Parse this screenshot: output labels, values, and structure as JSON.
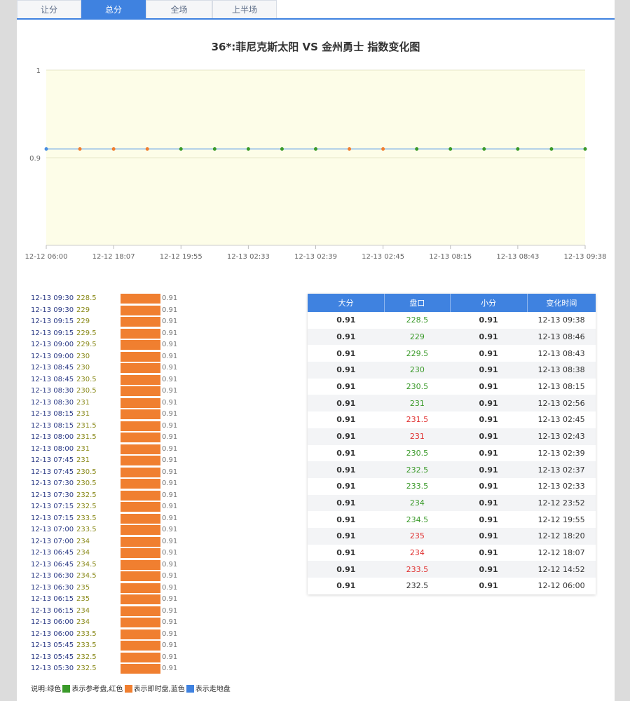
{
  "tabs": [
    "让分",
    "总分",
    "全场",
    "上半场"
  ],
  "active_tab": 1,
  "chart_data": {
    "type": "line",
    "title": "36*:菲尼克斯太阳 VS 金州勇士 指数变化图",
    "ylim": [
      0.8,
      1
    ],
    "yticks": [
      "1",
      "0.9"
    ],
    "xticks": [
      "12-12 06:00",
      "12-12 18:07",
      "12-12 19:55",
      "12-13 02:33",
      "12-13 02:39",
      "12-13 02:45",
      "12-13 08:15",
      "12-13 08:43",
      "12-13 09:38"
    ],
    "series": [
      {
        "values": [
          0.91,
          0.91,
          0.91,
          0.91,
          0.91,
          0.91,
          0.91,
          0.91,
          0.91,
          0.91,
          0.91,
          0.91,
          0.91,
          0.91,
          0.91,
          0.91,
          0.91
        ],
        "point_colors": [
          "#4a8fe0",
          "#f07f30",
          "#f07f30",
          "#f07f30",
          "#3a9a2a",
          "#3a9a2a",
          "#3a9a2a",
          "#3a9a2a",
          "#3a9a2a",
          "#f07f30",
          "#f07f30",
          "#3a9a2a",
          "#3a9a2a",
          "#3a9a2a",
          "#3a9a2a",
          "#3a9a2a",
          "#3a9a2a"
        ]
      }
    ],
    "line_color": "#7fb2e8",
    "plot_bg": "#fdfde8"
  },
  "rows": [
    {
      "time": "12-13 09:30",
      "line": "228.5",
      "value": "0.91"
    },
    {
      "time": "12-13 09:30",
      "line": "229",
      "value": "0.91"
    },
    {
      "time": "12-13 09:15",
      "line": "229",
      "value": "0.91"
    },
    {
      "time": "12-13 09:15",
      "line": "229.5",
      "value": "0.91"
    },
    {
      "time": "12-13 09:00",
      "line": "229.5",
      "value": "0.91"
    },
    {
      "time": "12-13 09:00",
      "line": "230",
      "value": "0.91"
    },
    {
      "time": "12-13 08:45",
      "line": "230",
      "value": "0.91"
    },
    {
      "time": "12-13 08:45",
      "line": "230.5",
      "value": "0.91"
    },
    {
      "time": "12-13 08:30",
      "line": "230.5",
      "value": "0.91"
    },
    {
      "time": "12-13 08:30",
      "line": "231",
      "value": "0.91"
    },
    {
      "time": "12-13 08:15",
      "line": "231",
      "value": "0.91"
    },
    {
      "time": "12-13 08:15",
      "line": "231.5",
      "value": "0.91"
    },
    {
      "time": "12-13 08:00",
      "line": "231.5",
      "value": "0.91"
    },
    {
      "time": "12-13 08:00",
      "line": "231",
      "value": "0.91"
    },
    {
      "time": "12-13 07:45",
      "line": "231",
      "value": "0.91"
    },
    {
      "time": "12-13 07:45",
      "line": "230.5",
      "value": "0.91"
    },
    {
      "time": "12-13 07:30",
      "line": "230.5",
      "value": "0.91"
    },
    {
      "time": "12-13 07:30",
      "line": "232.5",
      "value": "0.91"
    },
    {
      "time": "12-13 07:15",
      "line": "232.5",
      "value": "0.91"
    },
    {
      "time": "12-13 07:15",
      "line": "233.5",
      "value": "0.91"
    },
    {
      "time": "12-13 07:00",
      "line": "233.5",
      "value": "0.91"
    },
    {
      "time": "12-13 07:00",
      "line": "234",
      "value": "0.91"
    },
    {
      "time": "12-13 06:45",
      "line": "234",
      "value": "0.91"
    },
    {
      "time": "12-13 06:45",
      "line": "234.5",
      "value": "0.91"
    },
    {
      "time": "12-13 06:30",
      "line": "234.5",
      "value": "0.91"
    },
    {
      "time": "12-13 06:30",
      "line": "235",
      "value": "0.91"
    },
    {
      "time": "12-13 06:15",
      "line": "235",
      "value": "0.91"
    },
    {
      "time": "12-13 06:15",
      "line": "234",
      "value": "0.91"
    },
    {
      "time": "12-13 06:00",
      "line": "234",
      "value": "0.91"
    },
    {
      "time": "12-13 06:00",
      "line": "233.5",
      "value": "0.91"
    },
    {
      "time": "12-13 05:45",
      "line": "233.5",
      "value": "0.91"
    },
    {
      "time": "12-13 05:45",
      "line": "232.5",
      "value": "0.91"
    },
    {
      "time": "12-13 05:30",
      "line": "232.5",
      "value": "0.91"
    }
  ],
  "bar_color": "#f07f30",
  "legend": {
    "prefix": "说明:绿色",
    "green_text": "表示参考盘,红色",
    "orange_text": "表示即时盘,蓝色",
    "blue_text": "表示走地盘"
  },
  "table": {
    "headers": [
      "大分",
      "盘口",
      "小分",
      "变化时间"
    ],
    "rows": [
      {
        "over": "0.91",
        "line": "228.5",
        "under": "0.91",
        "time": "12-13 09:38",
        "color": "green"
      },
      {
        "over": "0.91",
        "line": "229",
        "under": "0.91",
        "time": "12-13 08:46",
        "color": "green"
      },
      {
        "over": "0.91",
        "line": "229.5",
        "under": "0.91",
        "time": "12-13 08:43",
        "color": "green"
      },
      {
        "over": "0.91",
        "line": "230",
        "under": "0.91",
        "time": "12-13 08:38",
        "color": "green"
      },
      {
        "over": "0.91",
        "line": "230.5",
        "under": "0.91",
        "time": "12-13 08:15",
        "color": "green"
      },
      {
        "over": "0.91",
        "line": "231",
        "under": "0.91",
        "time": "12-13 02:56",
        "color": "green"
      },
      {
        "over": "0.91",
        "line": "231.5",
        "under": "0.91",
        "time": "12-13 02:45",
        "color": "red"
      },
      {
        "over": "0.91",
        "line": "231",
        "under": "0.91",
        "time": "12-13 02:43",
        "color": "red"
      },
      {
        "over": "0.91",
        "line": "230.5",
        "under": "0.91",
        "time": "12-13 02:39",
        "color": "green"
      },
      {
        "over": "0.91",
        "line": "232.5",
        "under": "0.91",
        "time": "12-13 02:37",
        "color": "green"
      },
      {
        "over": "0.91",
        "line": "233.5",
        "under": "0.91",
        "time": "12-13 02:33",
        "color": "green"
      },
      {
        "over": "0.91",
        "line": "234",
        "under": "0.91",
        "time": "12-12 23:52",
        "color": "green"
      },
      {
        "over": "0.91",
        "line": "234.5",
        "under": "0.91",
        "time": "12-12 19:55",
        "color": "green"
      },
      {
        "over": "0.91",
        "line": "235",
        "under": "0.91",
        "time": "12-12 18:20",
        "color": "red"
      },
      {
        "over": "0.91",
        "line": "234",
        "under": "0.91",
        "time": "12-12 18:07",
        "color": "red"
      },
      {
        "over": "0.91",
        "line": "233.5",
        "under": "0.91",
        "time": "12-12 14:52",
        "color": "red"
      },
      {
        "over": "0.91",
        "line": "232.5",
        "under": "0.91",
        "time": "12-12 06:00",
        "color": "neutral"
      }
    ]
  },
  "colors": {
    "green": "#3a9a2a",
    "orange": "#f07f30",
    "blue": "#3f82e0"
  }
}
